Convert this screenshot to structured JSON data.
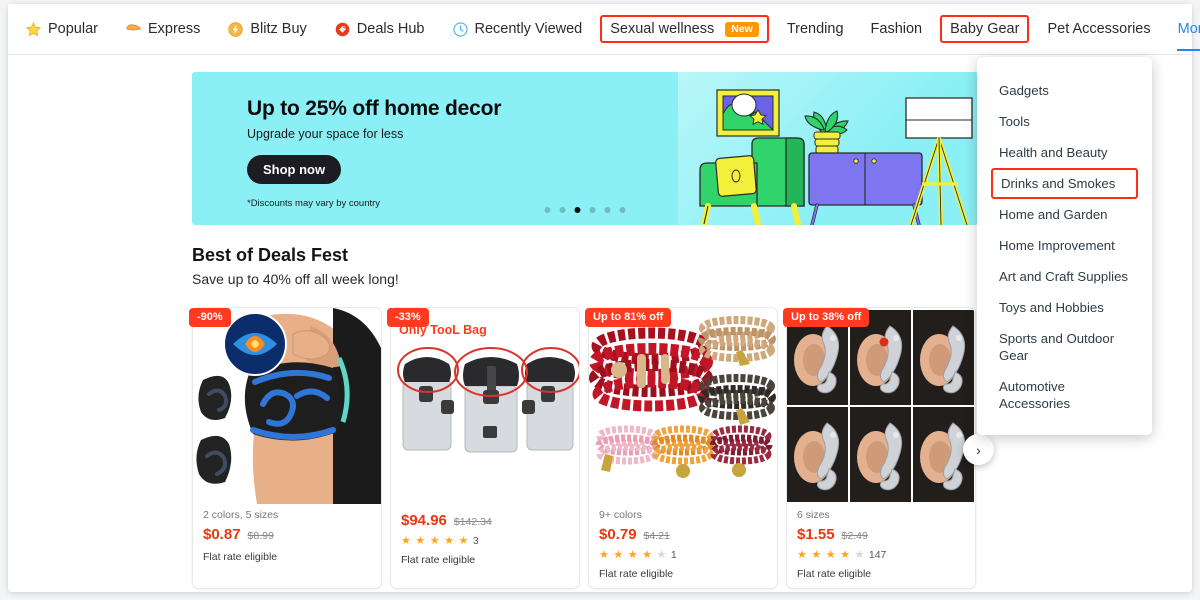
{
  "nav": {
    "items": [
      {
        "label": "Popular",
        "icon": "star-icon",
        "highlighted": false,
        "badge": null
      },
      {
        "label": "Express",
        "icon": "package-icon",
        "highlighted": false,
        "badge": null
      },
      {
        "label": "Blitz Buy",
        "icon": "lightning-icon",
        "highlighted": false,
        "badge": null
      },
      {
        "label": "Deals Hub",
        "icon": "tag-icon",
        "highlighted": false,
        "badge": null
      },
      {
        "label": "Recently Viewed",
        "icon": "clock-icon",
        "highlighted": false,
        "badge": null
      },
      {
        "label": "Sexual wellness",
        "icon": null,
        "highlighted": true,
        "badge": "New"
      },
      {
        "label": "Trending",
        "icon": null,
        "highlighted": false,
        "badge": null
      },
      {
        "label": "Fashion",
        "icon": null,
        "highlighted": false,
        "badge": null
      },
      {
        "label": "Baby Gear",
        "icon": null,
        "highlighted": true,
        "badge": null
      },
      {
        "label": "Pet Accessories",
        "icon": null,
        "highlighted": false,
        "badge": null
      },
      {
        "label": "More",
        "icon": null,
        "highlighted": false,
        "badge": null
      }
    ]
  },
  "more_menu": {
    "items": [
      {
        "label": "Gadgets",
        "highlighted": false
      },
      {
        "label": "Tools",
        "highlighted": false
      },
      {
        "label": "Health and Beauty",
        "highlighted": false
      },
      {
        "label": "Drinks and Smokes",
        "highlighted": true
      },
      {
        "label": "Home and Garden",
        "highlighted": false
      },
      {
        "label": "Home Improvement",
        "highlighted": false
      },
      {
        "label": "Art and Craft Supplies",
        "highlighted": false
      },
      {
        "label": "Toys and Hobbies",
        "highlighted": false
      },
      {
        "label": "Sports and Outdoor Gear",
        "highlighted": false
      },
      {
        "label": "Automotive Accessories",
        "highlighted": false
      }
    ]
  },
  "banner": {
    "title": "Up to 25% off home decor",
    "subtitle": "Upgrade your space for less",
    "cta_label": "Shop now",
    "note": "*Discounts may vary by country",
    "background_color": "#8af0f5",
    "dots_total": 6,
    "dots_active_index": 2
  },
  "section": {
    "title": "Best of Deals Fest",
    "subtitle": "Save up to 40% off all week long!"
  },
  "products": [
    {
      "discount_badge": "-90%",
      "image_overlay_text": null,
      "variant": "2 colors, 5 sizes",
      "price": "$0.87",
      "old_price": "$8.99",
      "rating": null,
      "rating_count": null,
      "shipping": "Flat rate eligible",
      "image_alt": "knee-compression-sleeve"
    },
    {
      "discount_badge": "-33%",
      "image_overlay_text": "Only TooL Bag",
      "variant": null,
      "price": "$94.96",
      "old_price": "$142.34",
      "rating": 5,
      "rating_count": "3",
      "shipping": "Flat rate eligible",
      "image_alt": "vacuum-cleaner-tool-bag"
    },
    {
      "discount_badge": "Up to 81% off",
      "image_overlay_text": null,
      "variant": "9+ colors",
      "price": "$0.79",
      "old_price": "$4.21",
      "rating": 4,
      "rating_count": "1",
      "shipping": "Flat rate eligible",
      "image_alt": "beaded-bracelet-set"
    },
    {
      "discount_badge": "Up to 38% off",
      "image_overlay_text": null,
      "variant": "6 sizes",
      "price": "$1.55",
      "old_price": "$2.49",
      "rating": 4,
      "rating_count": "147",
      "shipping": "Flat rate eligible",
      "image_alt": "elf-ear-cuff-earrings"
    }
  ],
  "carousel": {
    "next_label": "›"
  },
  "colors": {
    "accent_red": "#ff3a1f",
    "highlight_outline": "#ff2d16",
    "price_red": "#e8380d",
    "link_blue": "#1e8ae6",
    "badge_orange": "#ff9800",
    "banner_cyan": "#8af0f5"
  }
}
